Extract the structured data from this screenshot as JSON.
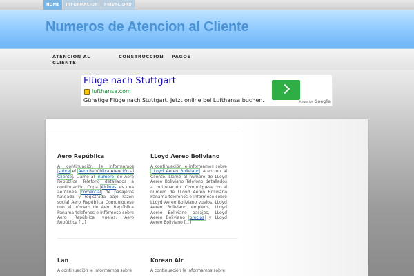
{
  "topnav": {
    "items": [
      "HOME",
      "INFORMACION",
      "PRIVACIDAD"
    ]
  },
  "header": {
    "title": "Numeros de Atencion al Cliente"
  },
  "mainnav": {
    "items": [
      "ATENCION AL\nCLIENTE",
      "CONSTRUCCION",
      "PAGOS"
    ]
  },
  "ad": {
    "title": "Flüge nach Stuttgart",
    "url": "lufthansa.com",
    "description": "Günstige Flüge nach Stuttgart. Jetzt online bei Lufthansa buchen.",
    "choice_label": "Anuncios",
    "choice_brand": "Google"
  },
  "posts": [
    {
      "title": "Aero República",
      "p1": "A continuación le informamos ",
      "l1": "sobre",
      "p2": " el ",
      "l2": "Aero República Atención al Cliente",
      "p3": ". Llame al ",
      "l3": "número",
      "p4": " de Aero República Telefono detallados a continuación. Copa ",
      "l4": "Airlines",
      "p5": " es una aerolínea ",
      "l5": "comercial",
      "p6": " de pasajeros fundada y registrada bajo razón social Aero República Comuníquese con el número de Aero República Panama telefonos e infórmese sobre Aero República vuelos, Aero República [...]"
    },
    {
      "title": "LLoyd Aereo Boliviano",
      "p1": "A continuación le informamos sobre ",
      "l1": "LLoyd Aereo Boliviano",
      "p2": " Atencion al Cliente. Llame al numero de LLoyd Aereo Boliviano Telefono detallados a continuación.. Comuníquese con el numero de LLoyd Aereo Boliviano Panama telefonos e infórmese sobre LLoyd Aereo Boliviano vuelos, LLoyd Aereo Boliviano empleos, LLoyd Aereo Boliviano pasajes, LLoyd Aereo Boliviano ",
      "l2": "precios",
      "p3": " y LLoyd Aereo Boliviano [...]"
    },
    {
      "title": "Lan",
      "p1": "A continuación le informamos sobre"
    },
    {
      "title": "Korean Air",
      "p1": "A continuación le informamos sobre"
    }
  ]
}
